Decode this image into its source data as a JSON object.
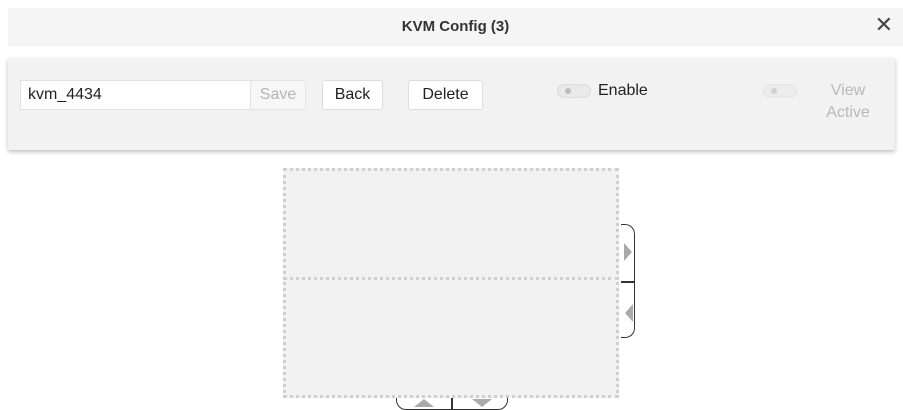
{
  "window": {
    "title": "KVM Config (3)",
    "close_glyph": "✕"
  },
  "toolbar": {
    "name_value": "kvm_4434",
    "save_label": "Save",
    "back_label": "Back",
    "delete_label": "Delete",
    "enable_label": "Enable",
    "enable_on": false,
    "view_active_label_line1": "View",
    "view_active_label_line2": "Active",
    "view_active_on": false
  },
  "layout_editor": {
    "panels": [
      "top-display",
      "bottom-display"
    ],
    "side_controls": [
      "move-right-arrow-icon",
      "move-left-arrow-icon"
    ],
    "bottom_controls": [
      "move-up-arrow-icon",
      "move-down-arrow-icon"
    ]
  },
  "colors": {
    "toolbar_bg": "#f2f2f2",
    "disabled_text": "#b8b8b8",
    "panel_border": "#cfcfcf"
  }
}
